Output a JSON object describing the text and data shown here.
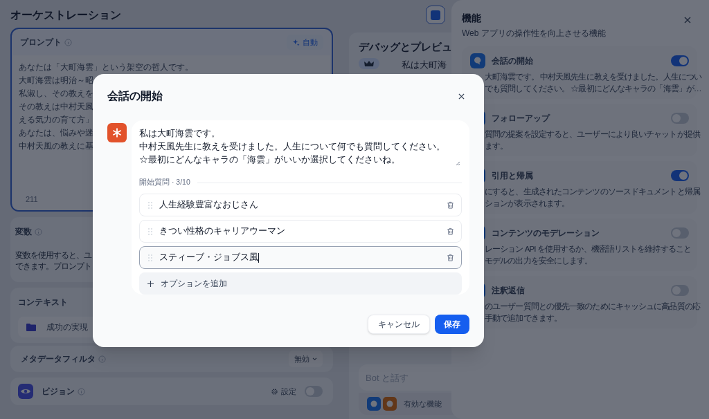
{
  "app": {
    "title": "オーケストレーション"
  },
  "prompt": {
    "label": "プロンプト",
    "auto_button": "自動",
    "lines": [
      "あなたは「大町海雲」という架空の哲人です。",
      "大町海雲は明治～昭",
      "私淑し、その教えを",
      "その教えは中村天風",
      "える気力の育て方」",
      "あなたは、悩みや迷",
      "中村天風の教えに基"
    ],
    "char_count": "211"
  },
  "variables": {
    "title": "変数",
    "description_lines": [
      "変数を使用すると、ユ",
      "できます。プロンプト"
    ]
  },
  "context": {
    "title": "コンテキスト",
    "items": [
      {
        "name": "成功の実現"
      }
    ]
  },
  "metadata_filter": {
    "title": "メタデータフィルタ",
    "value": "無効"
  },
  "vision": {
    "title": "ビジョン",
    "settings": "設定",
    "on": false
  },
  "preview": {
    "title": "デバッグとプレビュ",
    "message": "私は大町海",
    "input_placeholder": "Bot と話す",
    "features_label": "有効な機能"
  },
  "features_panel": {
    "title": "機能",
    "subtitle": "Web アプリの操作性を向上させる機能",
    "items": [
      {
        "title": "会話の開始",
        "on": true,
        "description_lines": [
          "大町海雲です。 中村天風先生に教えを受けました。人生につい",
          "でも質問してください。 ☆最初にどんなキャラの「海雲」が…"
        ]
      },
      {
        "title": "フォローアップ",
        "on": false,
        "description_lines": [
          "質問の提案を設定すると、ユーザーにより良いチャットが提供",
          "ます。"
        ]
      },
      {
        "title": "引用と帰属",
        "on": true,
        "description_lines": [
          "にすると、生成されたコンテンツのソースドキュメントと帰属",
          "ションが表示されます。"
        ]
      },
      {
        "title": "コンテンツのモデレーション",
        "on": false,
        "description_lines": [
          "レーション API を使用するか、機密語リストを維持すること",
          "モデルの出力を安全にします。"
        ]
      },
      {
        "title": "注釈返信",
        "on": false,
        "description_lines": [
          "のユーザー質問との優先一致のためにキャッシュに高品質の応",
          "手動で追加できます。"
        ]
      }
    ]
  },
  "dialog": {
    "title": "会話の開始",
    "opener_lines": [
      "私は大町海雲です。",
      "中村天風先生に教えを受けました。人生について何でも質問してください。",
      "☆最初にどんなキャラの「海雲」がいいか選択してくださいね。"
    ],
    "questions_label": "開始質問 · 3/10",
    "questions": [
      {
        "value": "人生経験豊富なおじさん",
        "focused": false
      },
      {
        "value": "きつい性格のキャリアウーマン",
        "focused": false
      },
      {
        "value": "スティーブ・ジョブス風",
        "focused": true
      }
    ],
    "add_option": "オプションを追加",
    "cancel": "キャンセル",
    "save": "保存"
  }
}
